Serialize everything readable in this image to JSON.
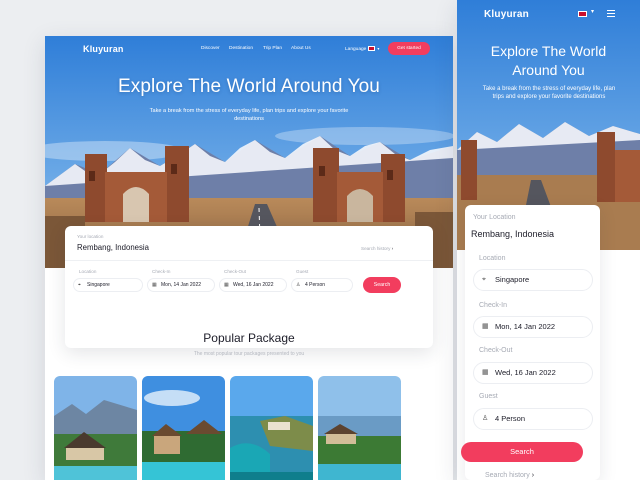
{
  "desktop": {
    "nav": {
      "logo": "Kluyuran",
      "links": [
        "Discover",
        "Destination",
        "Trip Plan",
        "About Us"
      ],
      "language_label": "Language",
      "cta": "Get started"
    },
    "hero": {
      "title": "Explore The World Around You",
      "subtitle": "Take a break from the stress of everyday life, plan trips and explore your favorite destinations"
    },
    "search": {
      "location_label": "Your location",
      "location_value": "Rembang, Indonesia",
      "history": "Search history",
      "fields": [
        {
          "label": "Location",
          "value": "Singapore",
          "icon": "pin-icon"
        },
        {
          "label": "Check-In",
          "value": "Mon, 14 Jan 2022",
          "icon": "calendar-icon"
        },
        {
          "label": "Check-Out",
          "value": "Wed, 16 Jan 2022",
          "icon": "calendar-icon"
        },
        {
          "label": "Guest",
          "value": "4 Person",
          "icon": "user-icon"
        }
      ],
      "button": "Search"
    },
    "popular": {
      "title": "Popular Package",
      "subtitle": "The most popular tour packages presented to you"
    }
  },
  "mobile": {
    "logo": "Kluyuran",
    "hero": {
      "title_line1": "Explore The World",
      "title_line2": "Around You",
      "subtitle": "Take a break from the stress of everyday life, plan trips and explore your favorite destinations"
    },
    "search": {
      "location_label": "Your Location",
      "location_value": "Rembang, Indonesia",
      "fields": [
        {
          "label": "Location",
          "value": "Singapore"
        },
        {
          "label": "Check-In",
          "value": "Mon, 14 Jan 2022"
        },
        {
          "label": "Check-Out",
          "value": "Wed, 16 Jan 2022"
        },
        {
          "label": "Guest",
          "value": "4 Person"
        }
      ],
      "button": "Search",
      "history": "Search history"
    }
  },
  "colors": {
    "accent": "#f23d5e",
    "sky_top": "#2f7ed8",
    "sky_bottom": "#9cc6ec",
    "text_muted": "#a6aab4"
  }
}
